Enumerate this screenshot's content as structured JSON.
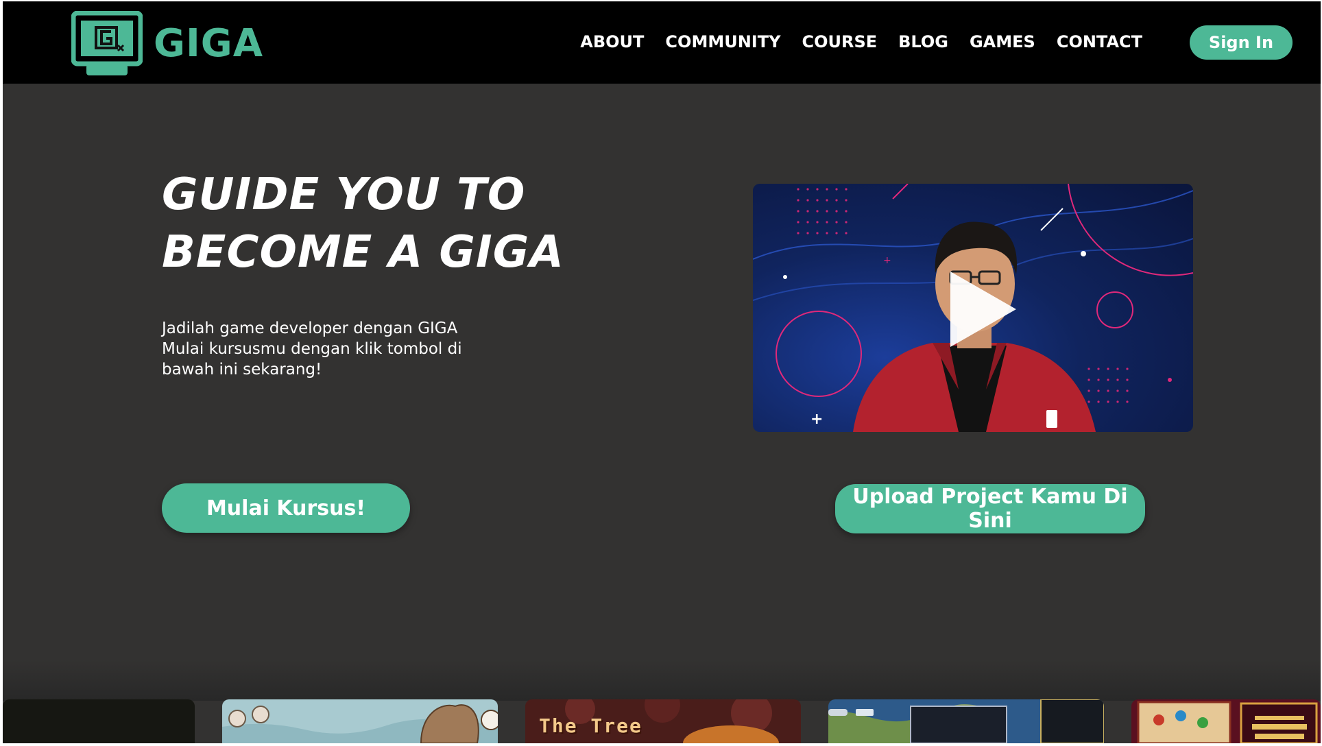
{
  "brand": {
    "name": "GIGA",
    "accent": "#4db896"
  },
  "nav": {
    "links": [
      "ABOUT",
      "COMMUNITY",
      "COURSE",
      "BLOG",
      "GAMES",
      "CONTACT"
    ],
    "signin_label": "Sign In"
  },
  "hero": {
    "title_line1": "GUIDE YOU TO",
    "title_line2": "BECOME A GIGA",
    "desc_line1": "Jadilah game developer dengan GIGA",
    "desc_line2": "Mulai kursusmu dengan klik tombol di",
    "desc_line3": "bawah ini sekarang!",
    "video_icon": "play-icon",
    "start_button": "Mulai Kursus!",
    "upload_button": "Upload Project Kamu Di Sini"
  },
  "games": {
    "thumbs": [
      {
        "title": "",
        "bg": "#161712"
      },
      {
        "title": "",
        "bg": "#a8cad0"
      },
      {
        "title": "The Tree",
        "bg": "#4a1d1a"
      },
      {
        "title": "",
        "bg": "#2d5a8a"
      },
      {
        "title": "",
        "bg": "#5a1020"
      }
    ]
  }
}
